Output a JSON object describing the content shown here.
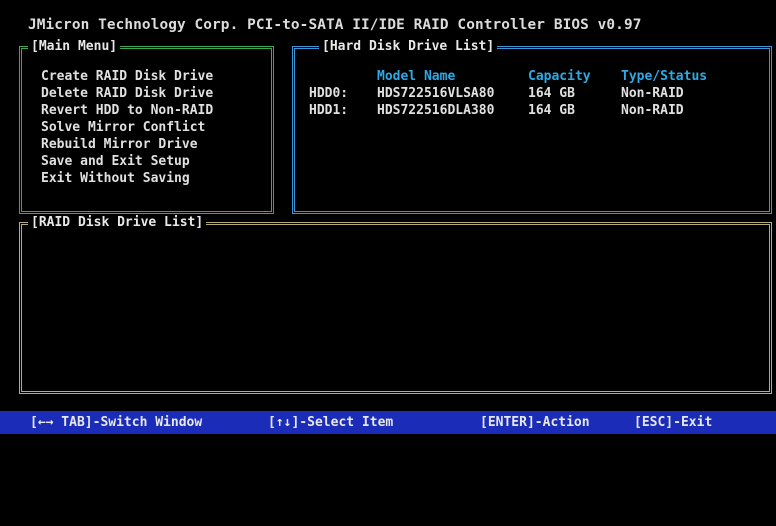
{
  "title": "JMicron Technology Corp. PCI-to-SATA II/IDE RAID Controller BIOS v0.97",
  "main_menu": {
    "label": "[Main Menu]",
    "items": [
      "Create RAID Disk Drive",
      "Delete RAID Disk Drive",
      "Revert HDD to Non-RAID",
      "Solve Mirror Conflict",
      "Rebuild Mirror Drive",
      "Save and Exit Setup",
      "Exit Without Saving"
    ]
  },
  "hdd_list": {
    "label": "[Hard Disk Drive List]",
    "columns": {
      "model": "Model Name",
      "capacity": "Capacity",
      "type": "Type/Status"
    },
    "rows": [
      {
        "id": "HDD0:",
        "model": "HDS722516VLSA80",
        "capacity": "164 GB",
        "type": "Non-RAID"
      },
      {
        "id": "HDD1:",
        "model": "HDS722516DLA380",
        "capacity": "164 GB",
        "type": "Non-RAID"
      }
    ]
  },
  "raid_list": {
    "label": "[RAID Disk Drive List]"
  },
  "statusbar": {
    "switch": "[←→ TAB]-Switch Window",
    "select": "[↑↓]-Select Item",
    "action": "[ENTER]-Action",
    "exit": "[ESC]-Exit"
  },
  "colors": {
    "menu_border": "#3ea84d",
    "hdd_border": "#3a96d6",
    "raid_border": "#b5aa7a",
    "header_text": "#2fa9e6",
    "statusbar_bg": "#1a2cb8"
  }
}
